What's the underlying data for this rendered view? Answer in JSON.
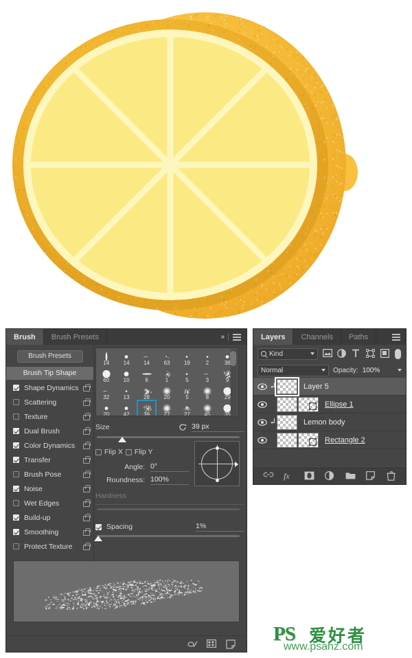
{
  "artwork": {
    "name": "lemon-slice-illustration",
    "colors": {
      "body": "#f9c440",
      "body_dark": "#eeab28",
      "rind": "#f2b730",
      "pith": "#fdf6bd",
      "flesh": "#fbe983",
      "background": "#ffffff"
    },
    "segments": 8
  },
  "watermark": {
    "ps": "PS",
    "cn": "爱好者",
    "url": "www.psahz.com",
    "color": "#2f9142"
  },
  "brush_panel": {
    "tabs": [
      {
        "label": "Brush",
        "active": true
      },
      {
        "label": "Brush Presets",
        "active": false
      }
    ],
    "header_icons": [
      "chevrons-right-icon",
      "panel-menu-icon"
    ],
    "presets_button": "Brush Presets",
    "tip_shape_row": "Brush Tip Shape",
    "options": [
      {
        "label": "Shape Dynamics",
        "checked": true,
        "locked": true
      },
      {
        "label": "Scattering",
        "checked": false,
        "locked": true
      },
      {
        "label": "Texture",
        "checked": false,
        "locked": true
      },
      {
        "label": "Dual Brush",
        "checked": true,
        "locked": true
      },
      {
        "label": "Color Dynamics",
        "checked": true,
        "locked": true
      },
      {
        "label": "Transfer",
        "checked": true,
        "locked": true
      },
      {
        "label": "Brush Pose",
        "checked": false,
        "locked": true
      },
      {
        "label": "Noise",
        "checked": true,
        "locked": true
      },
      {
        "label": "Wet Edges",
        "checked": false,
        "locked": true
      },
      {
        "label": "Build-up",
        "checked": true,
        "locked": true
      },
      {
        "label": "Smoothing",
        "checked": true,
        "locked": true
      },
      {
        "label": "Protect Texture",
        "checked": false,
        "locked": true
      }
    ],
    "tip_grid": {
      "rows": [
        [
          {
            "size": "14",
            "glyph": "streak-vertical"
          },
          {
            "size": "14",
            "glyph": "dot-small"
          },
          {
            "size": "14",
            "glyph": "flick"
          },
          {
            "size": "63",
            "glyph": "speck"
          },
          {
            "size": "19",
            "glyph": "dot-tiny"
          },
          {
            "size": "2",
            "glyph": "dot-tiny"
          },
          {
            "size": "36",
            "glyph": "dot-small"
          }
        ],
        [
          {
            "size": "60",
            "glyph": "dot-large"
          },
          {
            "size": "10",
            "glyph": "dot-med"
          },
          {
            "size": "6",
            "glyph": "bar"
          },
          {
            "size": "1",
            "glyph": "scatter"
          },
          {
            "size": "5",
            "glyph": "dot-tiny"
          },
          {
            "size": "3",
            "glyph": "flick"
          },
          {
            "size": "9",
            "glyph": "scribble"
          }
        ],
        [
          {
            "size": "32",
            "glyph": "flick"
          },
          {
            "size": "13",
            "glyph": "dot-tiny"
          },
          {
            "size": "28",
            "glyph": "scribble"
          },
          {
            "size": "20",
            "glyph": "soft-dot"
          },
          {
            "size": "5",
            "glyph": "scatter"
          },
          {
            "size": "8",
            "glyph": "soft-dot"
          },
          {
            "size": "29",
            "glyph": "dot-large"
          }
        ],
        [
          {
            "size": "20",
            "glyph": "dot-small"
          },
          {
            "size": "42",
            "glyph": "dot-small"
          },
          {
            "size": "39",
            "glyph": "scribble",
            "selected": true
          },
          {
            "size": "27",
            "glyph": "soft-dot"
          },
          {
            "size": "27",
            "glyph": "scatter"
          },
          {
            "size": "45",
            "glyph": "soft-dot"
          },
          {
            "size": "35",
            "glyph": "dot-large"
          }
        ]
      ]
    },
    "controls": {
      "size_label": "Size",
      "size_value": "39 px",
      "size_slider_pct": 18,
      "reset_icon": "reset-arrow-icon",
      "flip_x_label": "Flip X",
      "flip_x_checked": false,
      "flip_y_label": "Flip Y",
      "flip_y_checked": false,
      "angle_label": "Angle:",
      "angle_value": "0°",
      "roundness_label": "Roundness:",
      "roundness_value": "100%",
      "hardness_label": "Hardness",
      "hardness_disabled": true,
      "spacing_label": "Spacing",
      "spacing_checked": true,
      "spacing_value": "1%",
      "spacing_slider_pct": 1
    },
    "footer_icons": [
      "brush-toggle-icon",
      "preset-grid-icon",
      "new-brush-icon"
    ]
  },
  "layers_panel": {
    "tabs": [
      {
        "label": "Layers",
        "active": true
      },
      {
        "label": "Channels",
        "active": false
      },
      {
        "label": "Paths",
        "active": false
      }
    ],
    "menu_icon": "panel-menu-icon",
    "filter": {
      "kind_label": "Kind",
      "search_icon": "search-icon",
      "type_icons": [
        "pixel-filter-icon",
        "adjustment-filter-icon",
        "type-filter-icon",
        "shape-filter-icon",
        "smart-object-filter-icon"
      ],
      "toggle_icon": "filter-toggle-icon"
    },
    "blend": {
      "mode": "Normal",
      "opacity_label": "Opacity:",
      "opacity_value": "100%"
    },
    "layers": [
      {
        "name": "Layer 5",
        "visible": true,
        "selected": true,
        "clipped": true,
        "shape": false,
        "linked": false
      },
      {
        "name": "Ellipse 1",
        "visible": true,
        "selected": false,
        "clipped": false,
        "shape": true,
        "linked": true
      },
      {
        "name": "Lemon body",
        "visible": true,
        "selected": false,
        "clipped": true,
        "shape": false,
        "linked": false
      },
      {
        "name": "Rectangle 2",
        "visible": true,
        "selected": false,
        "clipped": false,
        "shape": true,
        "linked": true
      }
    ],
    "footer_icons": [
      "link-layers-icon",
      "fx-icon",
      "add-mask-icon",
      "adjustment-layer-icon",
      "new-group-icon",
      "new-layer-icon",
      "delete-layer-icon"
    ]
  }
}
